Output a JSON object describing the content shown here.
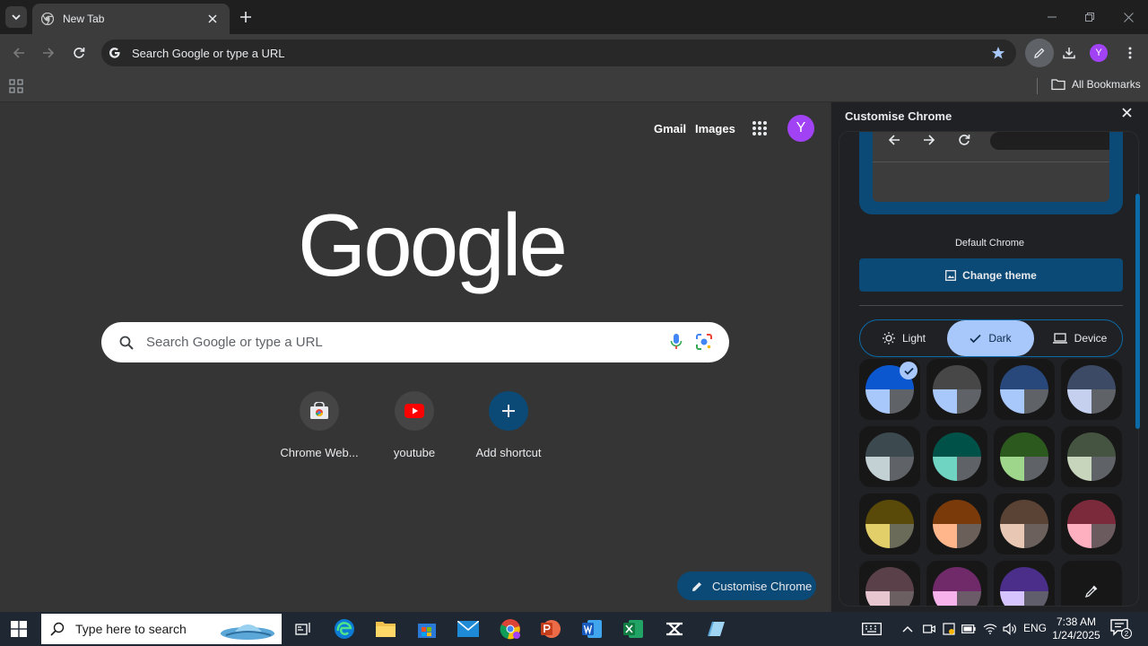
{
  "browser": {
    "tab": {
      "title": "New Tab"
    },
    "omnibox": {
      "text": "Search Google or type a URL"
    },
    "profile_initial": "Y",
    "bookmarks_bar": {
      "all_bookmarks": "All Bookmarks"
    }
  },
  "ntp": {
    "header_links": {
      "gmail": "Gmail",
      "images": "Images"
    },
    "avatar_initial": "Y",
    "logo": "Google",
    "search_placeholder": "Search Google or type a URL",
    "shortcuts": [
      {
        "label": "Chrome Web...",
        "icon": "chrome-web-store-icon"
      },
      {
        "label": "youtube",
        "icon": "youtube-icon"
      },
      {
        "label": "Add shortcut",
        "icon": "plus-icon"
      }
    ],
    "customise_button": "Customise Chrome"
  },
  "panel": {
    "title": "Customise Chrome",
    "theme_name": "Default Chrome",
    "change_theme": "Change theme",
    "modes": [
      {
        "label": "Light",
        "icon": "sun-icon",
        "active": false
      },
      {
        "label": "Dark",
        "icon": "check-icon",
        "active": true
      },
      {
        "label": "Device",
        "icon": "laptop-icon",
        "active": false
      }
    ],
    "swatches": [
      {
        "top": "#0b57d0",
        "bl": "#a8c7fa",
        "br": "#5f6368",
        "selected": true
      },
      {
        "top": "#474747",
        "bl": "#a8c7fa",
        "br": "#5f6368",
        "selected": false
      },
      {
        "top": "#28477a",
        "bl": "#a8c7fa",
        "br": "#5f6368",
        "selected": false
      },
      {
        "top": "#3d4a66",
        "bl": "#c4d0ee",
        "br": "#5f6368",
        "selected": false
      },
      {
        "top": "#3c4a4f",
        "bl": "#c3d0d4",
        "br": "#5f6368",
        "selected": false
      },
      {
        "top": "#005249",
        "bl": "#6fd5c2",
        "br": "#5f6368",
        "selected": false
      },
      {
        "top": "#2c5a1e",
        "bl": "#9ed68c",
        "br": "#5f6368",
        "selected": false
      },
      {
        "top": "#455440",
        "bl": "#c8d5bd",
        "br": "#5f6368",
        "selected": false
      },
      {
        "top": "#5a4a0a",
        "bl": "#e2cf6a",
        "br": "#6b6b5a",
        "selected": false
      },
      {
        "top": "#7a3a0a",
        "bl": "#ffb68a",
        "br": "#6b5f5a",
        "selected": false
      },
      {
        "top": "#5a4235",
        "bl": "#e8c8b4",
        "br": "#6b605c",
        "selected": false
      },
      {
        "top": "#7a2a3a",
        "bl": "#ffb0c0",
        "br": "#6b5a5e",
        "selected": false
      },
      {
        "top": "#5a4048",
        "bl": "#e8c6cf",
        "br": "#6b5f62",
        "selected": false
      },
      {
        "top": "#702a6a",
        "bl": "#f7b2ec",
        "br": "#6b5a68",
        "selected": false
      },
      {
        "top": "#4a2e8a",
        "bl": "#d6c4ff",
        "br": "#615e6b",
        "selected": false
      }
    ]
  },
  "taskbar": {
    "search_placeholder": "Type here to search",
    "language": "ENG",
    "time": "7:38 AM",
    "date": "1/24/2025",
    "notification_count": "2"
  }
}
